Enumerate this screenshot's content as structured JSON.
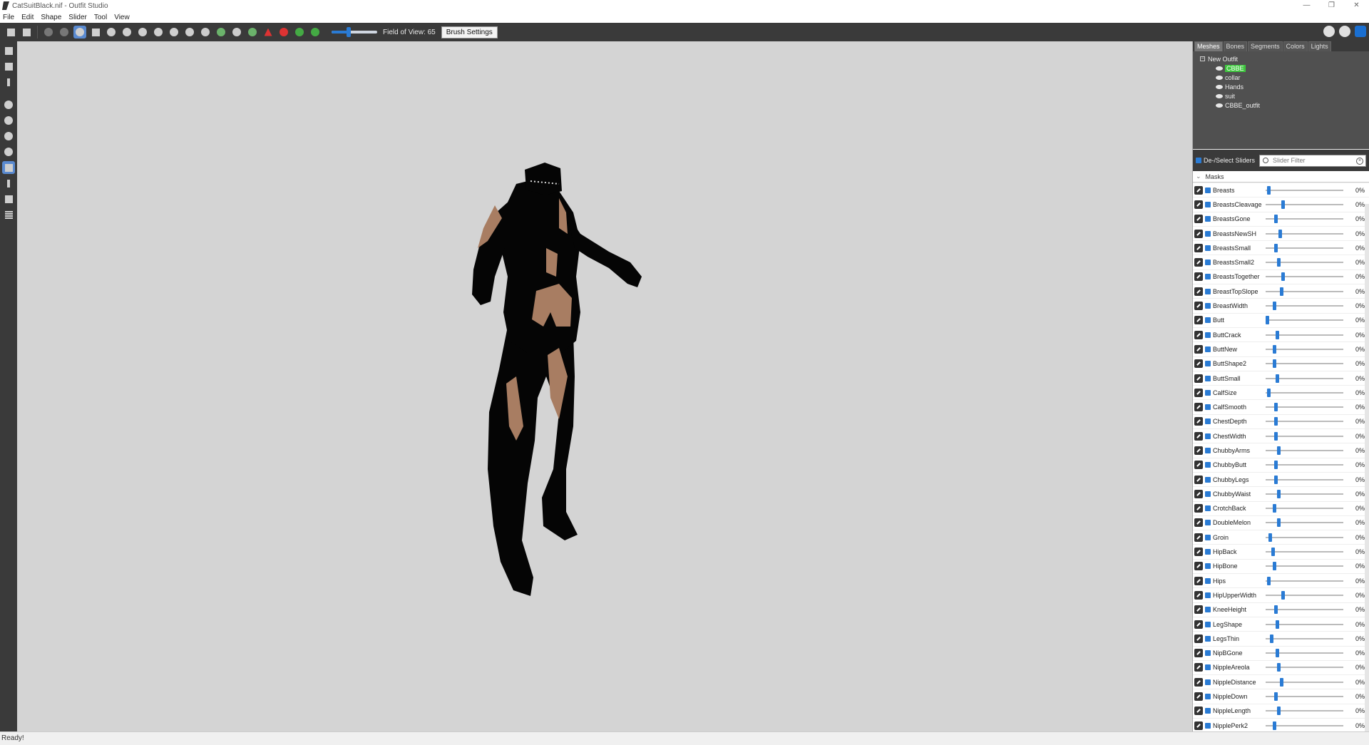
{
  "window": {
    "title": "CatSuitBlack.nif - Outfit Studio",
    "controls": [
      "—",
      "❐",
      "✕"
    ]
  },
  "menu": [
    "File",
    "Edit",
    "Shape",
    "Slider",
    "Tool",
    "View"
  ],
  "toolbar": {
    "fov_label": "Field of View: 65",
    "fov_value": 0.38,
    "brush_settings": "Brush Settings"
  },
  "panel": {
    "tabs": [
      "Meshes",
      "Bones",
      "Segments",
      "Colors",
      "Lights"
    ],
    "tree_root": "New Outfit",
    "meshes": [
      "CBBE",
      "collar",
      "Hands",
      "suit",
      "CBBE_outfit"
    ],
    "selected_mesh": "CBBE",
    "deselect_label": "De-/Select Sliders",
    "filter_placeholder": "Slider Filter",
    "masks_label": "Masks"
  },
  "sliders": [
    {
      "name": "Breasts",
      "value": "0%"
    },
    {
      "name": "BreastsCleavage",
      "value": "0%"
    },
    {
      "name": "BreastsGone",
      "value": "0%"
    },
    {
      "name": "BreastsNewSH",
      "value": "0%"
    },
    {
      "name": "BreastsSmall",
      "value": "0%"
    },
    {
      "name": "BreastsSmall2",
      "value": "0%"
    },
    {
      "name": "BreastsTogether",
      "value": "0%"
    },
    {
      "name": "BreastTopSlope",
      "value": "0%"
    },
    {
      "name": "BreastWidth",
      "value": "0%"
    },
    {
      "name": "Butt",
      "value": "0%"
    },
    {
      "name": "ButtCrack",
      "value": "0%"
    },
    {
      "name": "ButtNew",
      "value": "0%"
    },
    {
      "name": "ButtShape2",
      "value": "0%"
    },
    {
      "name": "ButtSmall",
      "value": "0%"
    },
    {
      "name": "CalfSize",
      "value": "0%"
    },
    {
      "name": "CalfSmooth",
      "value": "0%"
    },
    {
      "name": "ChestDepth",
      "value": "0%"
    },
    {
      "name": "ChestWidth",
      "value": "0%"
    },
    {
      "name": "ChubbyArms",
      "value": "0%"
    },
    {
      "name": "ChubbyButt",
      "value": "0%"
    },
    {
      "name": "ChubbyLegs",
      "value": "0%"
    },
    {
      "name": "ChubbyWaist",
      "value": "0%"
    },
    {
      "name": "CrotchBack",
      "value": "0%"
    },
    {
      "name": "DoubleMelon",
      "value": "0%"
    },
    {
      "name": "Groin",
      "value": "0%"
    },
    {
      "name": "HipBack",
      "value": "0%"
    },
    {
      "name": "HipBone",
      "value": "0%"
    },
    {
      "name": "Hips",
      "value": "0%"
    },
    {
      "name": "HipUpperWidth",
      "value": "0%"
    },
    {
      "name": "KneeHeight",
      "value": "0%"
    },
    {
      "name": "LegShape",
      "value": "0%"
    },
    {
      "name": "LegsThin",
      "value": "0%"
    },
    {
      "name": "NipBGone",
      "value": "0%"
    },
    {
      "name": "NippleAreola",
      "value": "0%"
    },
    {
      "name": "NippleDistance",
      "value": "0%"
    },
    {
      "name": "NippleDown",
      "value": "0%"
    },
    {
      "name": "NippleLength",
      "value": "0%"
    },
    {
      "name": "NipplePerk2",
      "value": "0%"
    }
  ],
  "status": "Ready!",
  "colors": {
    "accent": "#2a7bd4",
    "selected_mesh": "#3ec63e",
    "viewport": "#d4d4d4",
    "skin": "#a87d62",
    "suit": "#050505"
  }
}
